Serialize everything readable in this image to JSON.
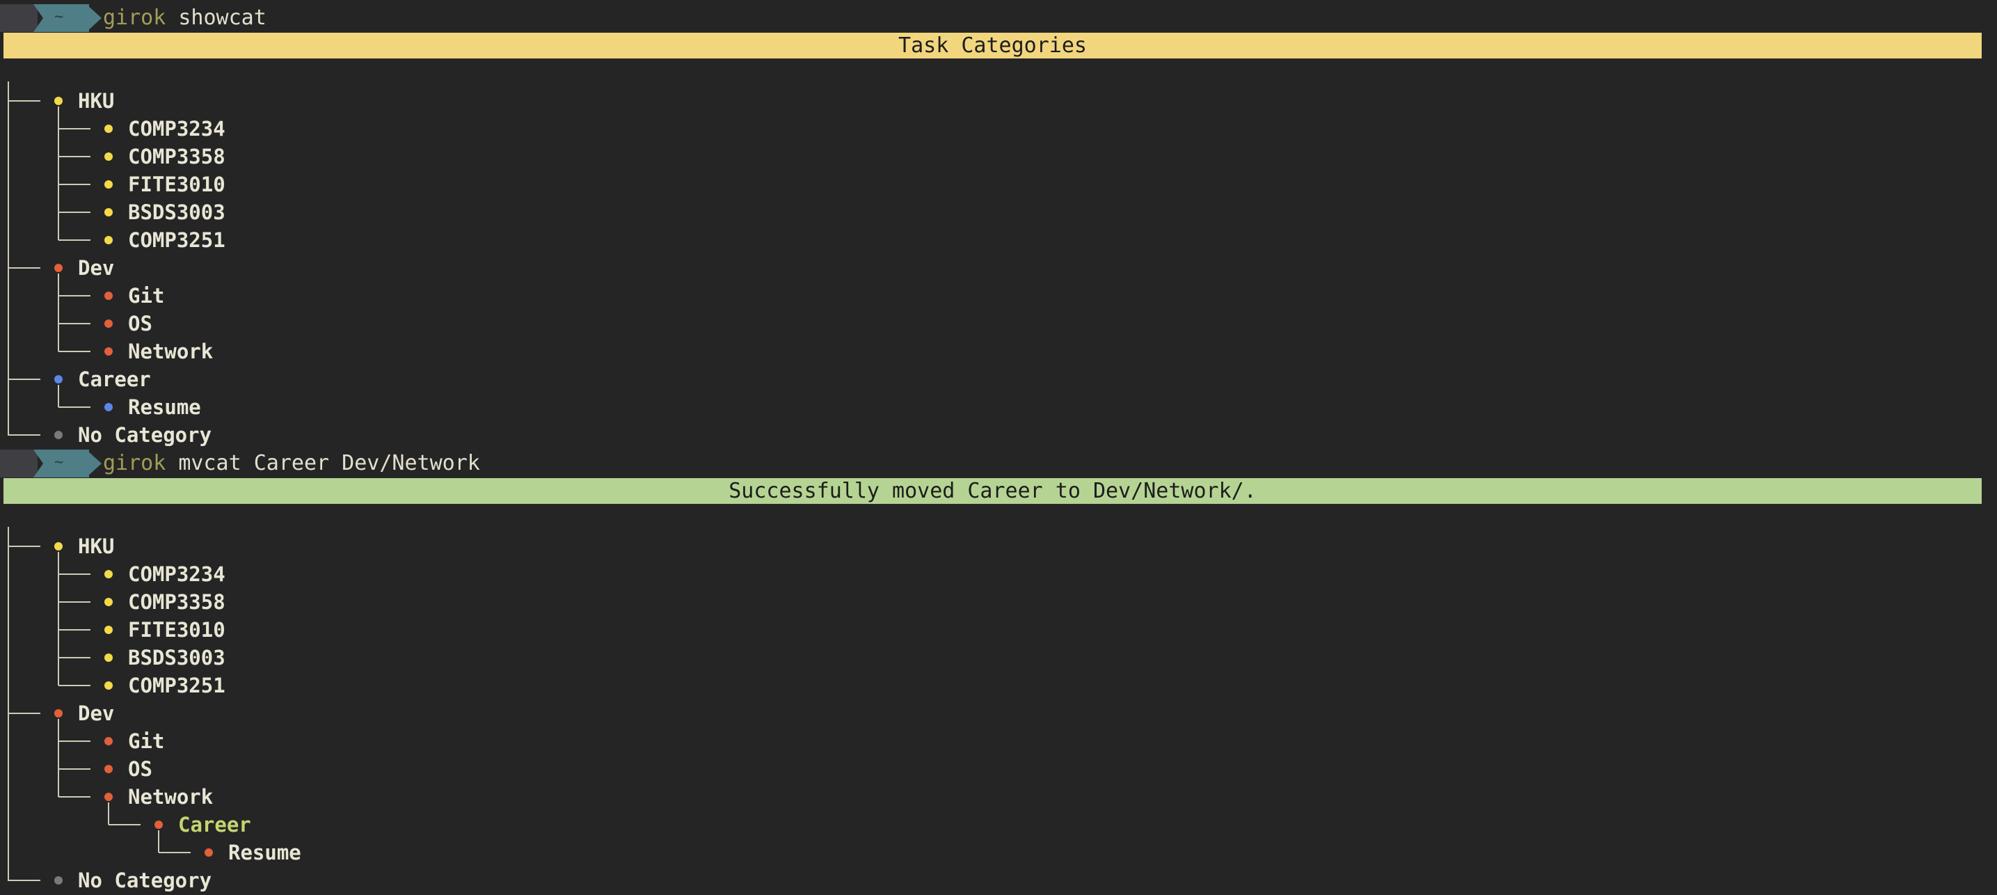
{
  "prompt": {
    "home_symbol": "~",
    "commands": [
      {
        "program": "girok",
        "args": " showcat"
      },
      {
        "program": "girok",
        "args": " mvcat Career Dev/Network"
      }
    ]
  },
  "banners": {
    "categories_title": "Task Categories",
    "success_message": "Successfully moved Career to Dev/Network/."
  },
  "colors": {
    "yellow": "#f4d94a",
    "orange": "#e2603a",
    "blue": "#5b86e6",
    "grey": "#7a7a7a",
    "tree_line": "#cfcbb4"
  },
  "tree_before": {
    "hku": "HKU",
    "hku_children": [
      "COMP3234",
      "COMP3358",
      "FITE3010",
      "BSDS3003",
      "COMP3251"
    ],
    "dev": "Dev",
    "dev_children": [
      "Git",
      "OS",
      "Network"
    ],
    "career": "Career",
    "career_children": [
      "Resume"
    ],
    "no_category": "No Category"
  },
  "tree_after": {
    "hku": "HKU",
    "hku_children": [
      "COMP3234",
      "COMP3358",
      "FITE3010",
      "BSDS3003",
      "COMP3251"
    ],
    "dev": "Dev",
    "dev_children": [
      "Git",
      "OS",
      "Network"
    ],
    "network_children": [
      "Career"
    ],
    "career_children": [
      "Resume"
    ],
    "no_category": "No Category"
  }
}
